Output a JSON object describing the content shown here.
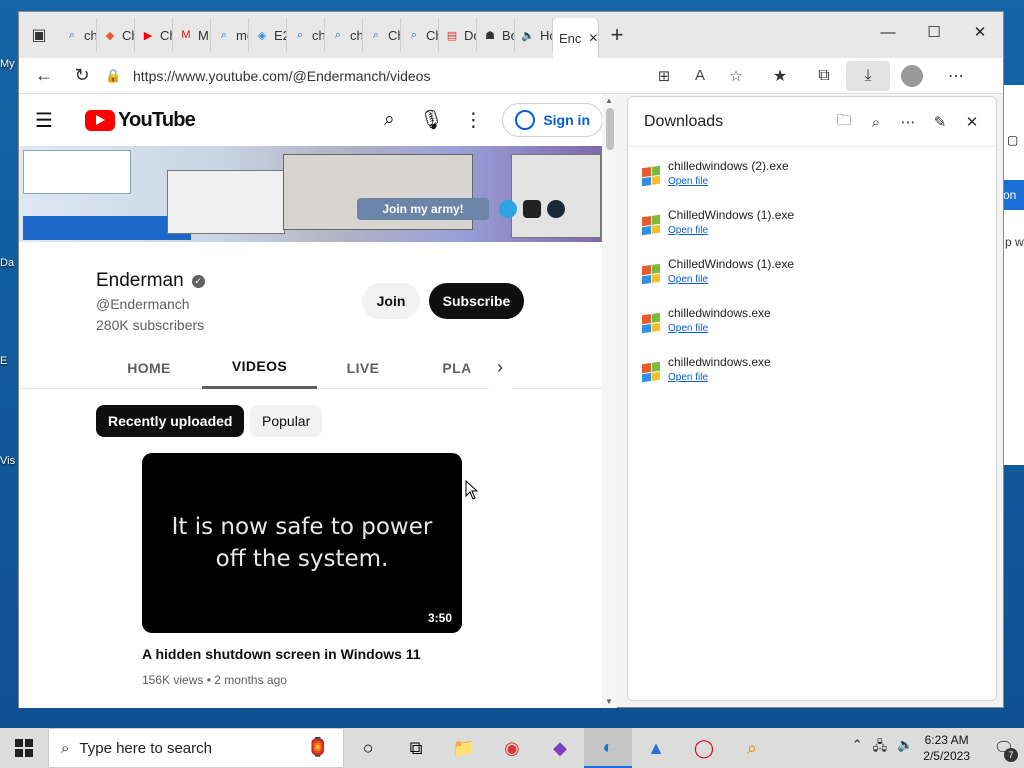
{
  "browser": {
    "tabs": [
      {
        "icon": "search-icon",
        "label": "chi"
      },
      {
        "icon": "windows-logo-icon",
        "label": "Ch"
      },
      {
        "icon": "youtube-icon",
        "label": "Ch"
      },
      {
        "icon": "m-logo-icon",
        "label": "ME"
      },
      {
        "icon": "search-icon",
        "label": "me"
      },
      {
        "icon": "map-icon",
        "label": "E2("
      },
      {
        "icon": "search-icon",
        "label": "chi"
      },
      {
        "icon": "search-icon",
        "label": "chi"
      },
      {
        "icon": "search-icon",
        "label": "Ch"
      },
      {
        "icon": "search-icon",
        "label": "Ch"
      },
      {
        "icon": "docs-icon",
        "label": "Do"
      },
      {
        "icon": "robot-icon",
        "label": "Bo"
      },
      {
        "icon": "speaker-icon",
        "label": "Ho"
      }
    ],
    "active_tab": {
      "label": "Enc"
    },
    "url": "https://www.youtube.com/@Endermanch/videos"
  },
  "youtube": {
    "logo_text": "YouTube",
    "sign_in": "Sign in",
    "banner_cta": "Join my army!",
    "channel": {
      "name": "Enderman",
      "handle": "@Endermanch",
      "subscribers": "280K subscribers",
      "join": "Join",
      "subscribe": "Subscribe"
    },
    "tabs": [
      "HOME",
      "VIDEOS",
      "LIVE",
      "PLA"
    ],
    "active_tab": "VIDEOS",
    "chips": [
      "Recently uploaded",
      "Popular"
    ],
    "video": {
      "thumbnail_text_1": "It is now safe to power",
      "thumbnail_text_2": "off the system.",
      "duration": "3:50",
      "title": "A hidden shutdown screen in Windows 11",
      "meta": "156K views • 2 months ago"
    }
  },
  "downloads": {
    "title": "Downloads",
    "items": [
      {
        "name": "chilledwindows (2).exe",
        "action": "Open file"
      },
      {
        "name": "ChilledWindows (1).exe",
        "action": "Open file"
      },
      {
        "name": "ChilledWindows (1).exe",
        "action": "Open file"
      },
      {
        "name": "chilledwindows.exe",
        "action": "Open file"
      },
      {
        "name": "chilledwindows.exe",
        "action": "Open file"
      }
    ]
  },
  "taskbar": {
    "search_placeholder": "Type here to search",
    "time": "6:23 AM",
    "date": "2/5/2023",
    "notification_count": "7"
  },
  "desktop": {
    "icon_labels": [
      "My",
      "Da",
      "E",
      "Vis"
    ],
    "strip_label": "on",
    "strip_text": "p w"
  }
}
